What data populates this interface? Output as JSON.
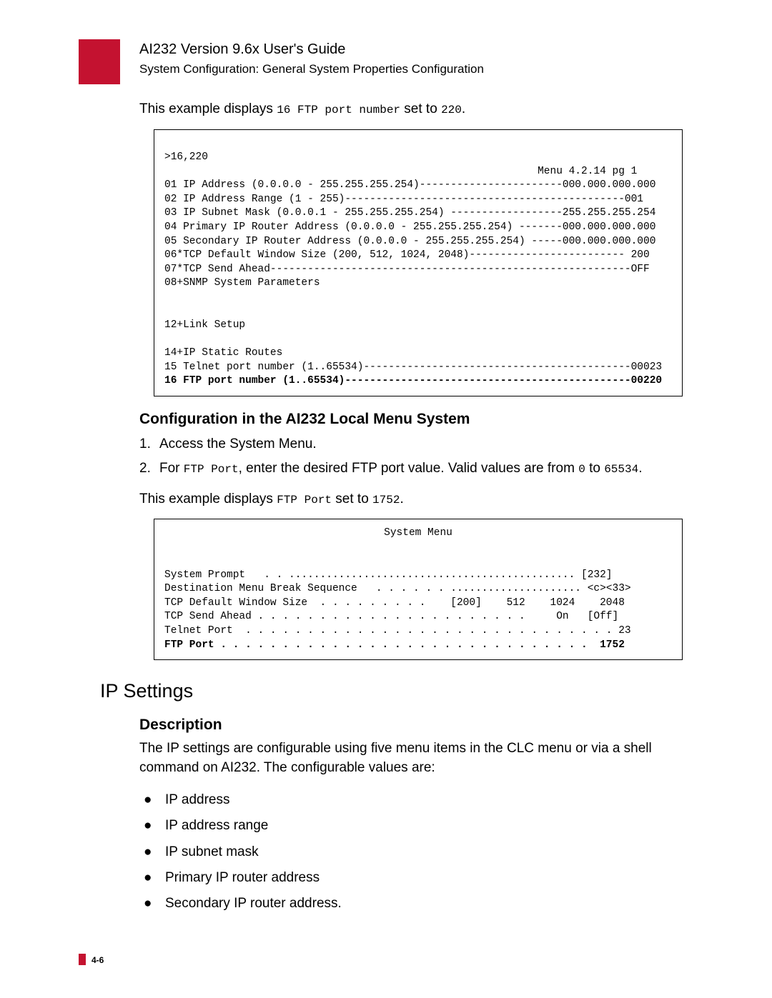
{
  "header": {
    "title": "AI232 Version 9.6x User's Guide",
    "sub": "System Configuration: General System Properties Configuration"
  },
  "intro": {
    "p1a": "This example displays ",
    "p1b": "16 FTP port number",
    "p1c": " set to ",
    "p1d": "220",
    "p1e": "."
  },
  "code1": {
    "l1": ">16,220",
    "l2": "                                                            Menu 4.2.14 pg 1",
    "l3": "01 IP Address (0.0.0.0 - 255.255.255.254)-----------------------000.000.000.000",
    "l4": "02 IP Address Range (1 - 255)---------------------------------------------001",
    "l5": "03 IP Subnet Mask (0.0.0.1 - 255.255.255.254) ------------------255.255.255.254",
    "l6": "04 Primary IP Router Address (0.0.0.0 - 255.255.255.254) -------000.000.000.000",
    "l7": "05 Secondary IP Router Address (0.0.0.0 - 255.255.255.254) -----000.000.000.000",
    "l8": "06*TCP Default Window Size (200, 512, 1024, 2048)------------------------- 200",
    "l9": "07*TCP Send Ahead----------------------------------------------------------OFF",
    "l10": "08+SNMP System Parameters",
    "l11": "",
    "l12": "",
    "l13": "12+Link Setup",
    "l14": "",
    "l15": "14+IP Static Routes",
    "l16": "15 Telnet port number (1..65534)-------------------------------------------00023",
    "l17": "16 FTP port number (1..65534)----------------------------------------------00220"
  },
  "section1": {
    "heading": "Configuration in the AI232 Local Menu System",
    "item1": "Access the System Menu.",
    "item2a": "For ",
    "item2b": "FTP Port",
    "item2c": ", enter the desired FTP port value. Valid values are from ",
    "item2d": "0",
    "item2e": " to ",
    "item2f": "65534",
    "item2g": ".",
    "p2a": "This example displays ",
    "p2b": "FTP Port",
    "p2c": " set to ",
    "p2d": "1752",
    "p2e": "."
  },
  "code2": {
    "title": "System Menu",
    "l1": "System Prompt   . . .............................................. [232]",
    "l2": "Destination Menu Break Sequence   . . . . . . ..................... <c><33>",
    "l3": "TCP Default Window Size  . . . . . . . . .    [200]    512    1024    2048",
    "l4": "TCP Send Ahead . . . . . . . . . . . . . . . . . . . . . .     On   [Off]",
    "l5": "Telnet Port  . . . . . . . . . . . . . . . . . . . . . . . . . . . . . . 23",
    "l6": "FTP Port . . . . . . . . . . . . . . . . . . . . . . . . . . . . . .  1752"
  },
  "ip": {
    "heading": "IP Settings",
    "descheading": "Description",
    "desc": "The IP settings are configurable using five menu items in the CLC menu or via a shell command on AI232. The configurable values are:",
    "b1": "IP address",
    "b2": "IP address range",
    "b3": "IP subnet mask",
    "b4": "Primary IP router address",
    "b5": "Secondary IP router address."
  },
  "footer": {
    "page": "4-6"
  }
}
